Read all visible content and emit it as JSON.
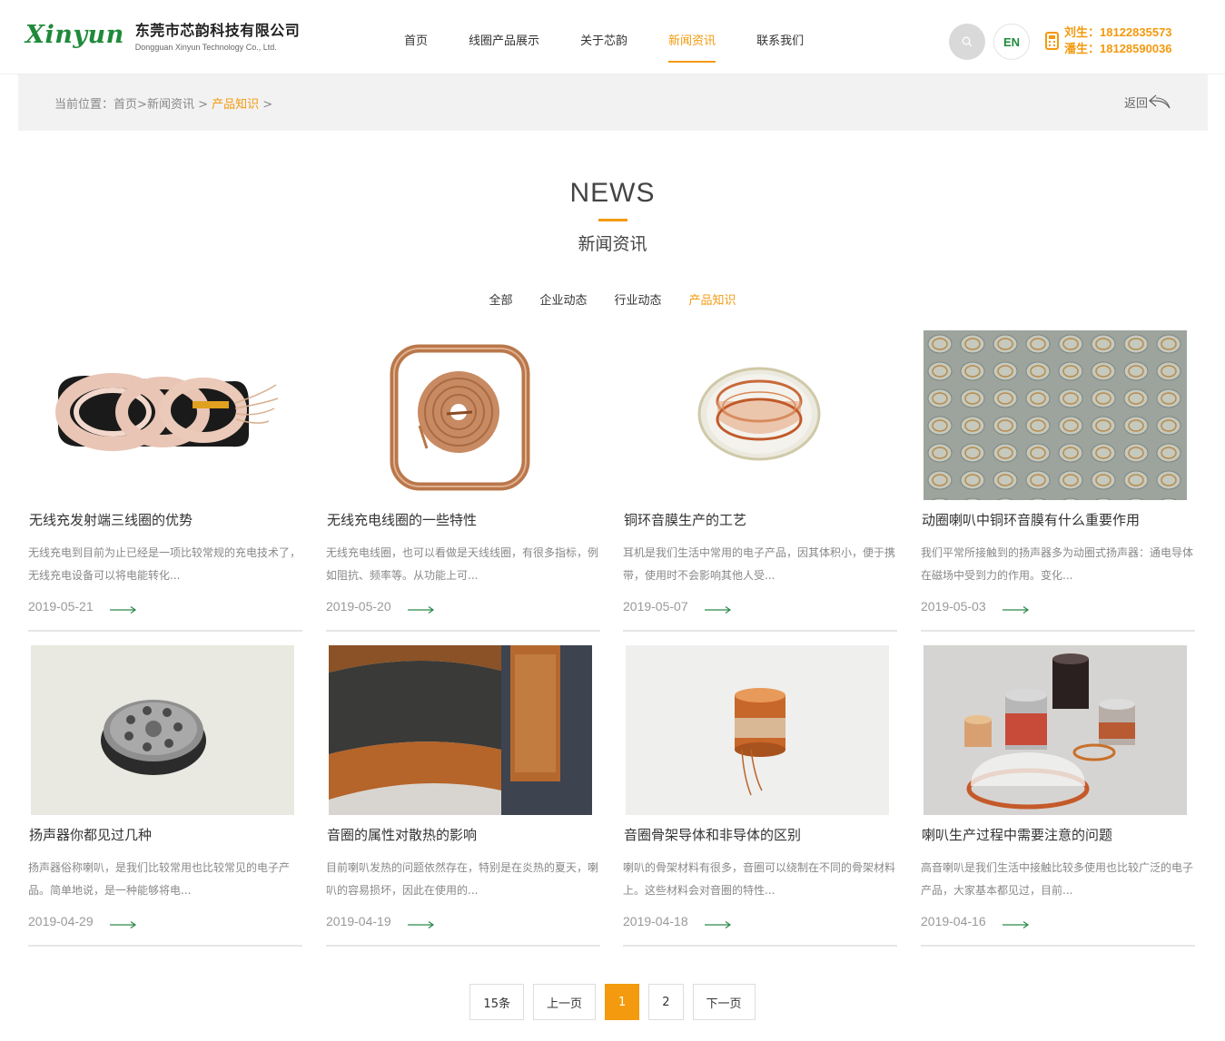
{
  "header": {
    "logo_mark": "Xinyun",
    "company_cn": "东莞市芯韵科技有限公司",
    "company_en": "Dongguan Xinyun Technology Co., Ltd.",
    "nav": [
      {
        "label": "首页",
        "active": false
      },
      {
        "label": "线圈产品展示",
        "active": false
      },
      {
        "label": "关于芯韵",
        "active": false
      },
      {
        "label": "新闻资讯",
        "active": true
      },
      {
        "label": "联系我们",
        "active": false
      }
    ],
    "lang_label": "EN",
    "phone_1": "刘生：18122835573",
    "phone_2": "潘生：18128590036"
  },
  "breadcrumb": {
    "prefix": "当前位置：",
    "home": "首页",
    "sep1": ">",
    "news": "新闻资讯",
    "sep2": " > ",
    "current": "产品知识",
    "sep3": " >",
    "back_label": "返回"
  },
  "section": {
    "title_en": "NEWS",
    "title_cn": "新闻资讯"
  },
  "tabs": [
    {
      "label": "全部",
      "active": false
    },
    {
      "label": "企业动态",
      "active": false
    },
    {
      "label": "行业动态",
      "active": false
    },
    {
      "label": "产品知识",
      "active": true
    }
  ],
  "articles": [
    {
      "title": "无线充发射端三线圈的优势",
      "desc": "无线充电到目前为止已经是一项比较常规的充电技术了，无线充电设备可以将电能转化...",
      "date": "2019-05-21",
      "image": "wireless-charger-triple-coil"
    },
    {
      "title": "无线充电线圈的一些特性",
      "desc": "无线充电线圈，也可以看做是天线线圈，有很多指标，例如阻抗、频率等。从功能上可...",
      "date": "2019-05-20",
      "image": "wireless-coil-copper"
    },
    {
      "title": "铜环音膜生产的工艺",
      "desc": "耳机是我们生活中常用的电子产品，因其体积小，便于携带，使用时不会影响其他人受...",
      "date": "2019-05-07",
      "image": "copper-ring-diaphragm"
    },
    {
      "title": "动圈喇叭中铜环音膜有什么重要作用",
      "desc": "我们平常所接触到的扬声器多为动圈式扬声器：通电导体在磁场中受到力的作用。变化...",
      "date": "2019-05-03",
      "image": "diaphragm-tray"
    },
    {
      "title": "扬声器你都见过几种",
      "desc": "扬声器俗称喇叭，是我们比较常用也比较常见的电子产品。简单地说，是一种能够将电...",
      "date": "2019-04-29",
      "image": "small-speaker"
    },
    {
      "title": "音圈的属性对散热的影响",
      "desc": "目前喇叭发热的问题依然存在，特别是在炎热的夏天，喇叭的容易损坏，因此在使用的...",
      "date": "2019-04-19",
      "image": "voice-coil-closeup"
    },
    {
      "title": "音圈骨架导体和非导体的区别",
      "desc": "喇叭的骨架材料有很多，音圈可以绕制在不同的骨架材料上。这些材料会对音圈的特性...",
      "date": "2019-04-18",
      "image": "voice-coil-bobbin"
    },
    {
      "title": "喇叭生产过程中需要注意的问题",
      "desc": "高音喇叭是我们生活中接触比较多使用也比较广泛的电子产品，大家基本都见过，目前...",
      "date": "2019-04-16",
      "image": "voice-coil-group"
    }
  ],
  "pagination": {
    "total": "15条",
    "prev": "上一页",
    "pages": [
      "1",
      "2"
    ],
    "current": "1",
    "next": "下一页"
  },
  "colors": {
    "accent": "#f39a0e",
    "brand_green": "#1f8a3a",
    "arrow_green": "#2a8a4a"
  }
}
